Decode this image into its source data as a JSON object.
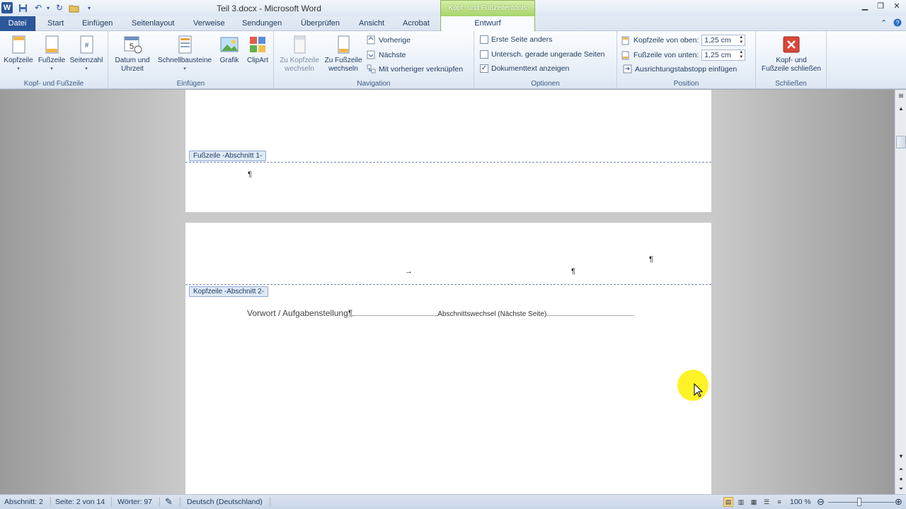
{
  "window": {
    "title": "Teil 3.docx - Microsoft Word",
    "contextual_group": "Kopf- und Fußzeilentools"
  },
  "tabs": [
    "Datei",
    "Start",
    "Einfügen",
    "Seitenlayout",
    "Verweise",
    "Sendungen",
    "Überprüfen",
    "Ansicht",
    "Acrobat",
    "Entwurf"
  ],
  "ribbon": {
    "groups": {
      "header_footer": {
        "label": "Kopf- und Fußzeile",
        "kopfzeile": "Kopfzeile",
        "fusszeile": "Fußzeile",
        "seitenzahl": "Seitenzahl"
      },
      "insert": {
        "label": "Einfügen",
        "datum_1": "Datum und",
        "datum_2": "Uhrzeit",
        "schnellbausteine": "Schnellbausteine",
        "grafik": "Grafik",
        "clipart": "ClipArt"
      },
      "navigation": {
        "label": "Navigation",
        "zu_kopf_1": "Zu Kopfzeile",
        "zu_kopf_2": "wechseln",
        "zu_fuss_1": "Zu Fußzeile",
        "zu_fuss_2": "wechseln",
        "vorherige": "Vorherige",
        "naechste": "Nächste",
        "verknuepfen": "Mit vorheriger verknüpfen"
      },
      "options": {
        "label": "Optionen",
        "erste_seite": "Erste Seite anders",
        "gerade_ungerade": "Untersch. gerade  ungerade Seiten",
        "dokumenttext": "Dokumenttext anzeigen",
        "erste_seite_checked": false,
        "gerade_ungerade_checked": false,
        "dokumenttext_checked": true
      },
      "position": {
        "label": "Position",
        "kopf_oben_label": "Kopfzeile von oben:",
        "kopf_oben_value": "1,25  cm",
        "fuss_unten_label": "Fußzeile von unten:",
        "fuss_unten_value": "1,25  cm",
        "ausrichtung": "Ausrichtungstabstopp einfügen"
      },
      "close": {
        "label": "Schließen",
        "btn_1": "Kopf- und",
        "btn_2": "Fußzeile schließen"
      }
    }
  },
  "document": {
    "footer_tag": "Fußzeile -Abschnitt 1-",
    "header_tag": "Kopfzeile -Abschnitt 2-",
    "pilcrow": "¶",
    "tab_arrow": "→",
    "body_text": "Vorwort / Aufgabenstellung¶",
    "section_break": "Abschnittswechsel (Nächste Seite)"
  },
  "status": {
    "abschnitt": "Abschnitt: 2",
    "seite": "Seite: 2 von 14",
    "woerter": "Wörter: 97",
    "sprache": "Deutsch (Deutschland)",
    "zoom": "100 %"
  },
  "colors": {
    "file_tab": "#2b579a",
    "contextual_tab": "#a7d36b",
    "pointer_highlight": "#fff000"
  }
}
